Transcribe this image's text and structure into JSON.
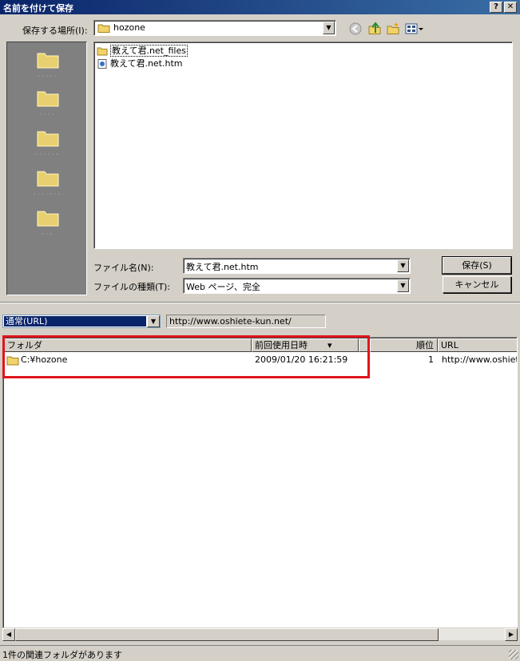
{
  "window": {
    "title": "名前を付けて保存",
    "help_label": "?",
    "close_label": "✕"
  },
  "save_in": {
    "label": "保存する場所(I):",
    "value": "hozone"
  },
  "files": [
    {
      "name": "教えて君.net_files",
      "type": "folder"
    },
    {
      "name": "教えて君.net.htm",
      "type": "htm"
    }
  ],
  "filename": {
    "label": "ファイル名(N):",
    "value": "教えて君.net.htm"
  },
  "filetype": {
    "label": "ファイルの種類(T):",
    "value": "Web ページ、完全"
  },
  "buttons": {
    "save": "保存(S)",
    "cancel": "キャンセル"
  },
  "mode_combo": {
    "value": "通常(URL)"
  },
  "url_display": "http://www.oshiete-kun.net/",
  "history": {
    "columns": [
      "フォルダ",
      "前回使用日時",
      "順位",
      "URL"
    ],
    "sort_indicator": "▾",
    "rows": [
      {
        "folder": "C:¥hozone",
        "last_used": "2009/01/20 16:21:59",
        "rank": "1",
        "url": "http://www.oshiete"
      }
    ]
  },
  "status": "1件の関連フォルダがあります",
  "colors": {
    "title_start": "#0a246a",
    "title_end": "#3a6ea5",
    "highlight": "#e0151b",
    "folder": "#f2d36b"
  }
}
